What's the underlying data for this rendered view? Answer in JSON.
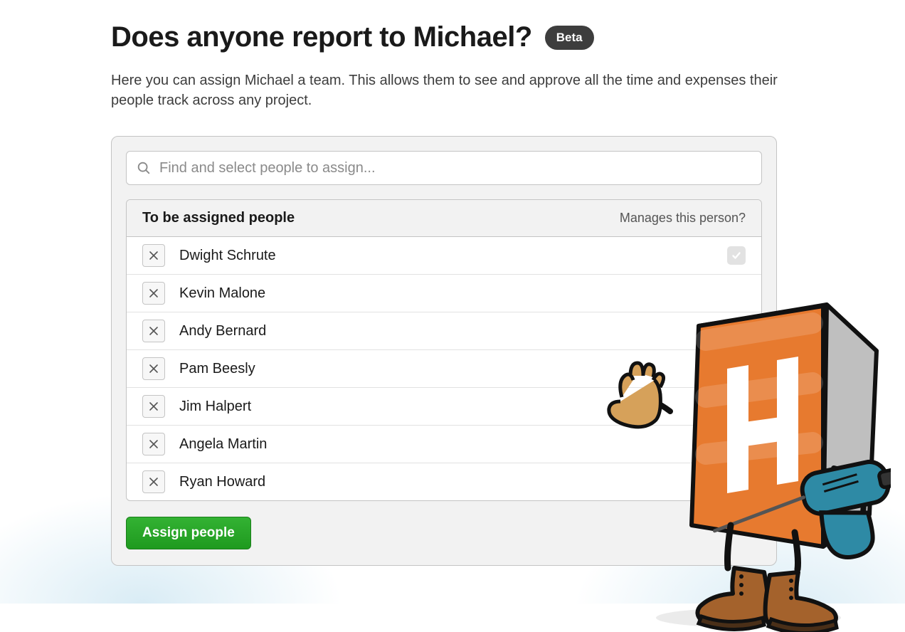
{
  "header": {
    "title": "Does anyone report to Michael?",
    "badge": "Beta"
  },
  "subheading": "Here you can assign Michael a team. This allows them to see and approve all the time and expenses their people track across any project.",
  "search": {
    "placeholder": "Find and select people to assign..."
  },
  "list": {
    "header_left": "To be assigned people",
    "header_right": "Manages this person?",
    "rows": [
      {
        "name": "Dwight Schrute",
        "manages_checked": true,
        "show_checkbox": true
      },
      {
        "name": "Kevin Malone",
        "manages_checked": false,
        "show_checkbox": false
      },
      {
        "name": "Andy Bernard",
        "manages_checked": false,
        "show_checkbox": false
      },
      {
        "name": "Pam Beesly",
        "manages_checked": false,
        "show_checkbox": false
      },
      {
        "name": "Jim Halpert",
        "manages_checked": false,
        "show_checkbox": false
      },
      {
        "name": "Angela Martin",
        "manages_checked": false,
        "show_checkbox": false
      },
      {
        "name": "Ryan Howard",
        "manages_checked": false,
        "show_checkbox": false
      }
    ]
  },
  "actions": {
    "assign_label": "Assign people"
  }
}
